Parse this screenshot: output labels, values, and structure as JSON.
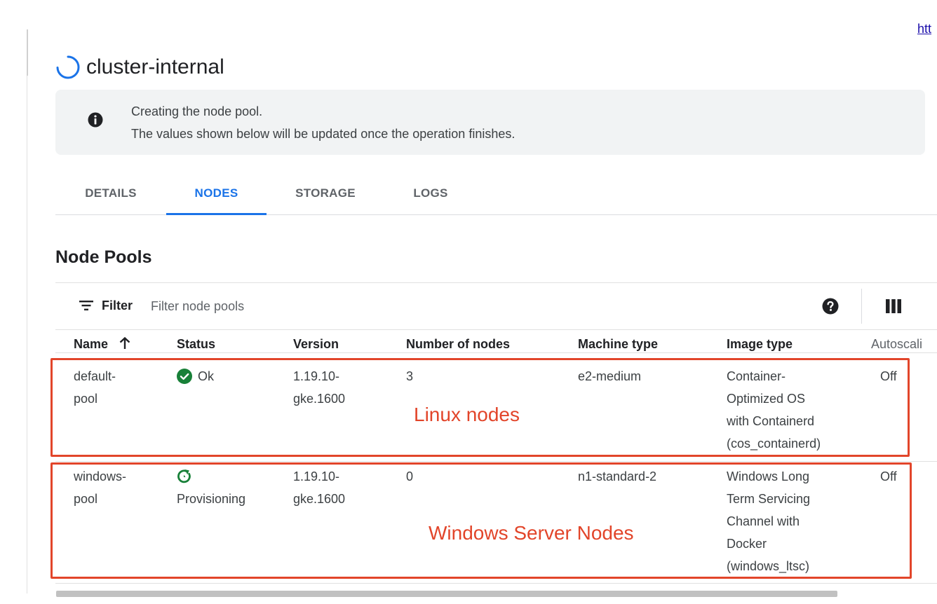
{
  "page": {
    "top_link_text": "htt",
    "cluster_name": "cluster-internal"
  },
  "banner": {
    "line1": "Creating the node pool.",
    "line2": "The values shown below will be updated once the operation finishes."
  },
  "tabs": [
    {
      "label": "DETAILS",
      "active": false
    },
    {
      "label": "NODES",
      "active": true
    },
    {
      "label": "STORAGE",
      "active": false
    },
    {
      "label": "LOGS",
      "active": false
    }
  ],
  "node_pools": {
    "section_title": "Node Pools",
    "filter_label": "Filter",
    "filter_placeholder": "Filter node pools",
    "columns": [
      "Name",
      "Status",
      "Version",
      "Number of nodes",
      "Machine type",
      "Image type",
      "Autoscali"
    ],
    "rows": [
      {
        "name": [
          "default-",
          "pool"
        ],
        "status": "Ok",
        "status_kind": "ok",
        "version": [
          "1.19.10-",
          "gke.1600"
        ],
        "node_count": "3",
        "machine_type": "e2-medium",
        "image_type": [
          "Container-",
          "Optimized OS",
          "with Containerd",
          "(cos_containerd)"
        ],
        "autoscaling": "Off"
      },
      {
        "name": [
          "windows-",
          "pool"
        ],
        "status": "Provisioning",
        "status_kind": "provisioning",
        "version": [
          "1.19.10-",
          "gke.1600"
        ],
        "node_count": "0",
        "machine_type": "n1-standard-2",
        "image_type": [
          "Windows Long",
          "Term Servicing",
          "Channel with",
          "Docker",
          "(windows_ltsc)"
        ],
        "autoscaling": "Off"
      }
    ]
  },
  "annotations": {
    "linux_label": "Linux nodes",
    "windows_label": "Windows Server Nodes"
  },
  "icons": {
    "spinner": "progress-spinner-icon",
    "info": "info-icon",
    "filter": "filter-icon",
    "help": "help-icon",
    "columns": "column-display-icon",
    "sort": "sort-ascending-icon",
    "ok": "check-circle-icon",
    "provisioning": "refresh-icon"
  },
  "colors": {
    "accent": "#1a73e8",
    "ok": "#188038",
    "annotation": "#e2452a",
    "banner_bg": "#f1f3f4"
  }
}
